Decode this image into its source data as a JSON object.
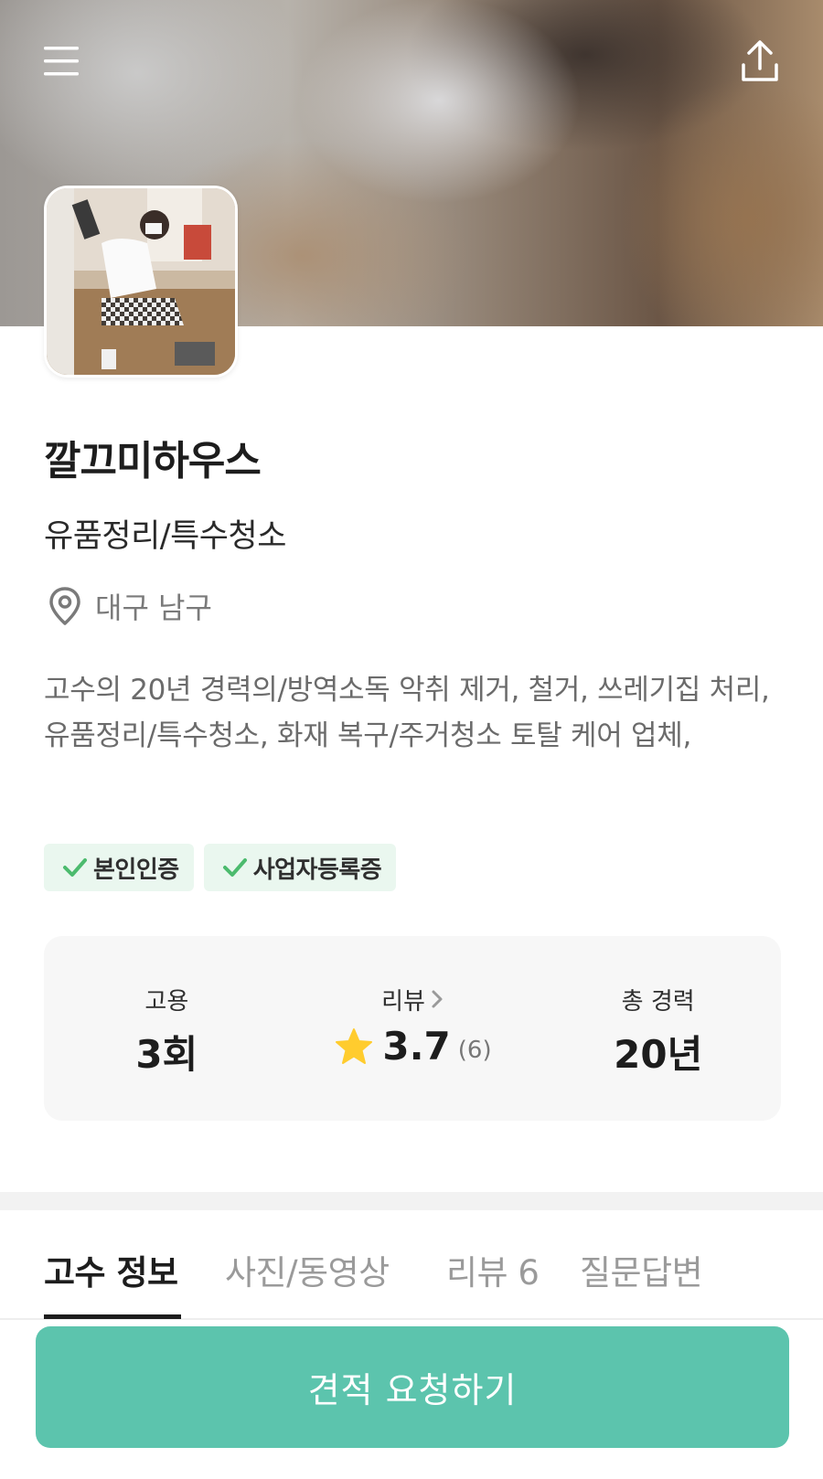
{
  "header": {
    "menu_icon": "hamburger-menu-icon",
    "share_icon": "share-upload-icon"
  },
  "profile": {
    "name": "깔끄미하우스",
    "category": "유품정리/특수청소",
    "location": "대구 남구",
    "description": "고수의 20년 경력의/방역소독 악취 제거, 철거, 쓰레기집 처리, 유품정리/특수청소, 화재 복구/주거청소 토탈 케어 업체,",
    "badges": [
      {
        "label": "본인인증"
      },
      {
        "label": "사업자등록증"
      }
    ]
  },
  "stats": {
    "hires": {
      "label": "고용",
      "value": "3회"
    },
    "reviews": {
      "label": "리뷰",
      "rating": "3.7",
      "count": "(6)"
    },
    "experience": {
      "label": "총 경력",
      "value": "20년"
    }
  },
  "tabs": [
    {
      "label": "고수 정보",
      "active": true
    },
    {
      "label": "사진/동영상",
      "active": false
    },
    {
      "label": "리뷰 6",
      "active": false
    },
    {
      "label": "질문답변",
      "active": false
    }
  ],
  "cta": {
    "label": "견적 요청하기"
  },
  "colors": {
    "accent": "#5cc4ad",
    "badge_bg": "#eaf7ef",
    "check": "#4cbb6e",
    "star": "#ffcc2e"
  }
}
